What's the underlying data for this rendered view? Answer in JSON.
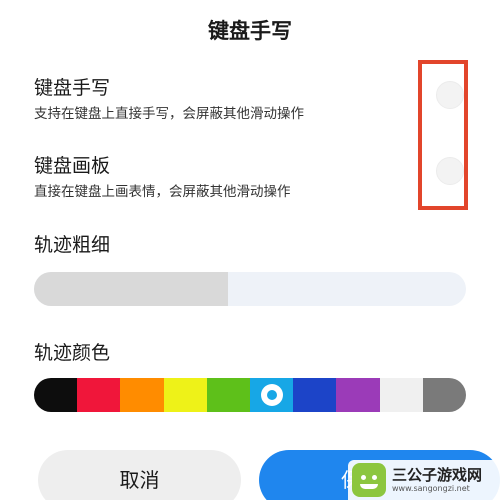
{
  "dialog": {
    "title": "键盘手写"
  },
  "settings": [
    {
      "title": "键盘手写",
      "description": "支持在键盘上直接手写，会屏蔽其他滑动操作",
      "enabled": false
    },
    {
      "title": "键盘画板",
      "description": "直接在键盘上画表情，会屏蔽其他滑动操作",
      "enabled": false
    }
  ],
  "stroke_width": {
    "label": "轨迹粗细",
    "value_fraction": 0.45
  },
  "stroke_color": {
    "label": "轨迹颜色",
    "selected_index": 5,
    "swatches": [
      "#0d0d0d",
      "#f0163a",
      "#ff8c00",
      "#eef218",
      "#5ec01a",
      "#17a7e6",
      "#1c44c8",
      "#9b3bb8",
      "#f0f0f0",
      "#7a7a7a"
    ]
  },
  "buttons": {
    "cancel": "取消",
    "save": "保"
  },
  "watermark": {
    "name": "三公子游戏网",
    "url": "www.sangongzi.net"
  },
  "colors": {
    "highlight": "#e2452b",
    "primary": "#1f86ee"
  }
}
